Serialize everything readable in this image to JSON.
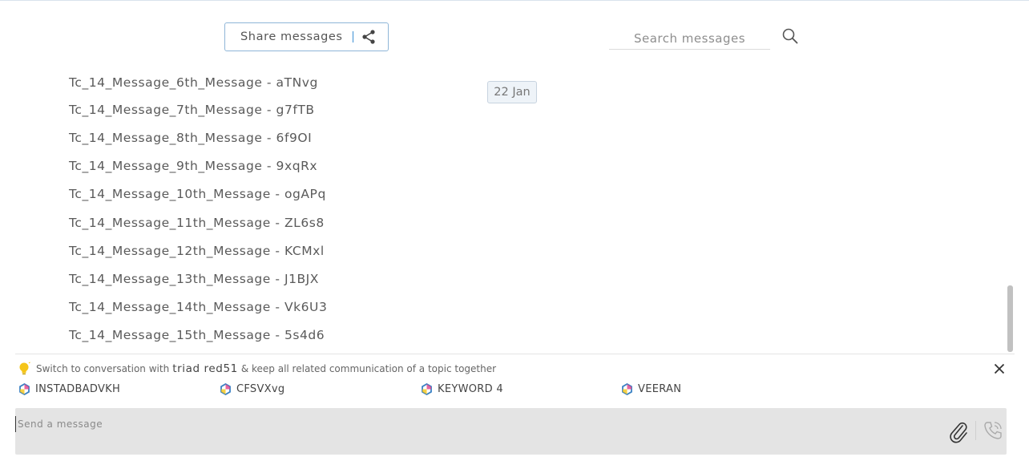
{
  "toolbar": {
    "share_label": "Share messages",
    "search_placeholder": "Search messages"
  },
  "date_chip": "22 Jan",
  "messages": [
    "Tc_14_Message_6th_Message - aTNvg",
    "Tc_14_Message_7th_Message - g7fTB",
    "Tc_14_Message_8th_Message - 6f9OI",
    "Tc_14_Message_9th_Message - 9xqRx",
    "Tc_14_Message_10th_Message - ogAPq",
    "Tc_14_Message_11th_Message - ZL6s8",
    "Tc_14_Message_12th_Message - KCMxl",
    "Tc_14_Message_13th_Message - J1BJX",
    "Tc_14_Message_14th_Message - Vk6U3",
    "Tc_14_Message_15th_Message - 5s4d6"
  ],
  "suggestion": {
    "prefix": "Switch to conversation with",
    "contact": "triad red51",
    "suffix": "& keep all related communication of a topic together",
    "chips": [
      "INSTADBADVKH",
      "CFSVXvg",
      "KEYWORD 4",
      "VEERAN"
    ]
  },
  "composer": {
    "placeholder": "Send a message"
  },
  "colors": {
    "accent_border": "#8fb6d8",
    "bulb": "#f5c518",
    "composer_bg": "#e4e4e4"
  },
  "icons": {
    "share": "share-icon",
    "search": "search-icon",
    "bulb": "lightbulb-icon",
    "close": "close-icon",
    "chip": "hexagon-icon",
    "attach": "paperclip-icon",
    "call": "phone-icon"
  }
}
